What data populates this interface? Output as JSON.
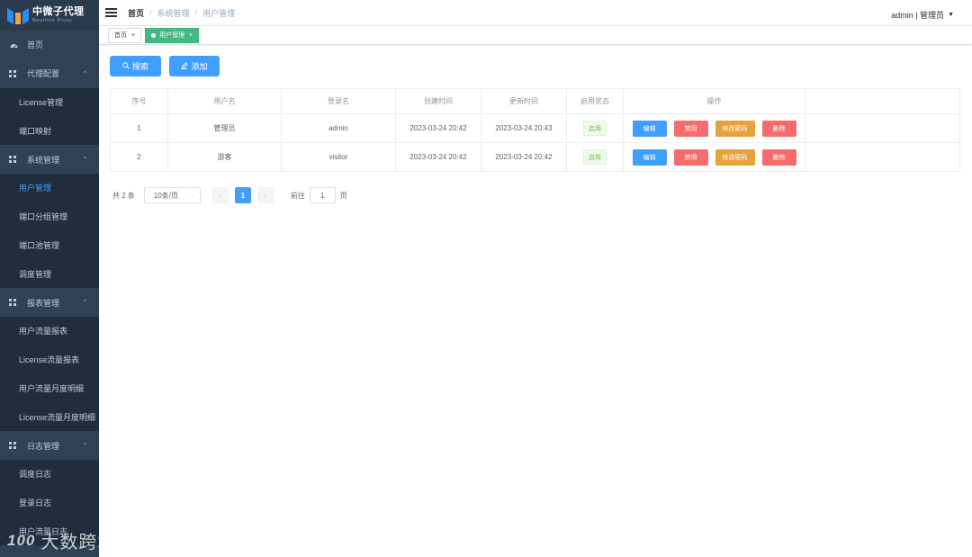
{
  "brand": {
    "title": "中微子代理",
    "subtitle": "Neutrino Proxy"
  },
  "sidebar": {
    "items": [
      {
        "label": "首页",
        "type": "top",
        "icon": "dashboard-icon"
      },
      {
        "label": "代理配置",
        "type": "group",
        "icon": "grid-icon"
      },
      {
        "label": "License管理",
        "type": "sub"
      },
      {
        "label": "端口映射",
        "type": "sub"
      },
      {
        "label": "系统管理",
        "type": "group",
        "icon": "grid-icon"
      },
      {
        "label": "用户管理",
        "type": "sub",
        "active": true
      },
      {
        "label": "端口分组管理",
        "type": "sub"
      },
      {
        "label": "端口池管理",
        "type": "sub"
      },
      {
        "label": "调度管理",
        "type": "sub"
      },
      {
        "label": "报表管理",
        "type": "group",
        "icon": "grid-icon"
      },
      {
        "label": "用户流量报表",
        "type": "sub"
      },
      {
        "label": "License流量报表",
        "type": "sub"
      },
      {
        "label": "用户流量月度明细",
        "type": "sub"
      },
      {
        "label": "License流量月度明细",
        "type": "sub"
      },
      {
        "label": "日志管理",
        "type": "group",
        "icon": "grid-icon"
      },
      {
        "label": "调度日志",
        "type": "sub"
      },
      {
        "label": "登录日志",
        "type": "sub"
      },
      {
        "label": "用户流量日志",
        "type": "sub"
      }
    ]
  },
  "header": {
    "breadcrumb": [
      "首页",
      "系统管理",
      "用户管理"
    ],
    "breadcrumb_sep": "/",
    "user": "admin | 管理员"
  },
  "tags": [
    {
      "label": "首页",
      "active": false
    },
    {
      "label": "用户管理",
      "active": true
    }
  ],
  "toolbar": {
    "search_label": "搜索",
    "add_label": "添加"
  },
  "table": {
    "columns": [
      "序号",
      "用户名",
      "登录名",
      "创建时间",
      "更新时间",
      "启用状态",
      "操作",
      ""
    ],
    "rows": [
      {
        "index": "1",
        "username": "管理员",
        "login": "admin",
        "created": "2023-03-24 20:42",
        "updated": "2023-03-24 20:43",
        "status": "启用"
      },
      {
        "index": "2",
        "username": "游客",
        "login": "visitor",
        "created": "2023-03-24 20:42",
        "updated": "2023-03-24 20:42",
        "status": "启用"
      }
    ],
    "actions": [
      {
        "label": "编辑",
        "color": "#409eff"
      },
      {
        "label": "禁用",
        "color": "#f56c6c"
      },
      {
        "label": "修改密码",
        "color": "#e6a23c"
      },
      {
        "label": "删除",
        "color": "#f56c6c"
      }
    ]
  },
  "pagination": {
    "total_text": "共 2 条",
    "page_size": "10条/页",
    "current_page": "1",
    "goto_label": "前往",
    "goto_value": "1",
    "page_suffix": "页"
  },
  "watermark": {
    "text": "大数跨境",
    "mark": "100"
  },
  "colors": {
    "sidebar_bg": "#304156",
    "primary": "#409eff",
    "success": "#67c23a",
    "danger": "#f56c6c",
    "warning": "#e6a23c",
    "tag_active": "#42b983"
  }
}
